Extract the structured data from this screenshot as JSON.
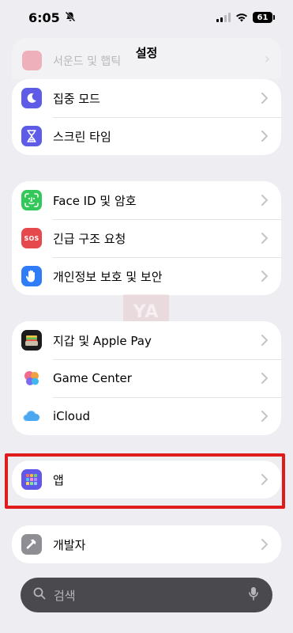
{
  "status": {
    "time": "6:05",
    "battery": "61"
  },
  "title": "설정",
  "ghost_row": {
    "label": "서운드 및 햅틱"
  },
  "group1": [
    {
      "id": "focus",
      "label": "집중 모드"
    },
    {
      "id": "screentime",
      "label": "스크린 타임"
    }
  ],
  "group2": [
    {
      "id": "faceid",
      "label": "Face ID 및 암호"
    },
    {
      "id": "sos",
      "label": "긴급 구조 요청",
      "icon_text": "SOS"
    },
    {
      "id": "privacy",
      "label": "개인정보 보호 및 보안"
    }
  ],
  "group3": [
    {
      "id": "wallet",
      "label": "지갑 및 Apple Pay"
    },
    {
      "id": "gamecenter",
      "label": "Game Center"
    },
    {
      "id": "icloud",
      "label": "iCloud"
    }
  ],
  "group4": [
    {
      "id": "apps",
      "label": "앱"
    }
  ],
  "group5": [
    {
      "id": "developer",
      "label": "개발자"
    }
  ],
  "search": {
    "placeholder": "검색"
  },
  "watermark": "YA",
  "colors": {
    "background": "#eeeef2",
    "highlight": "#e01b1b",
    "focus_icon": "#5e5ce6",
    "faceid_icon": "#34c759",
    "sos_icon": "#e5484d",
    "privacy_icon": "#2f7cf6",
    "apps_icon": "#6157e9",
    "developer_icon": "#8e8e93"
  }
}
